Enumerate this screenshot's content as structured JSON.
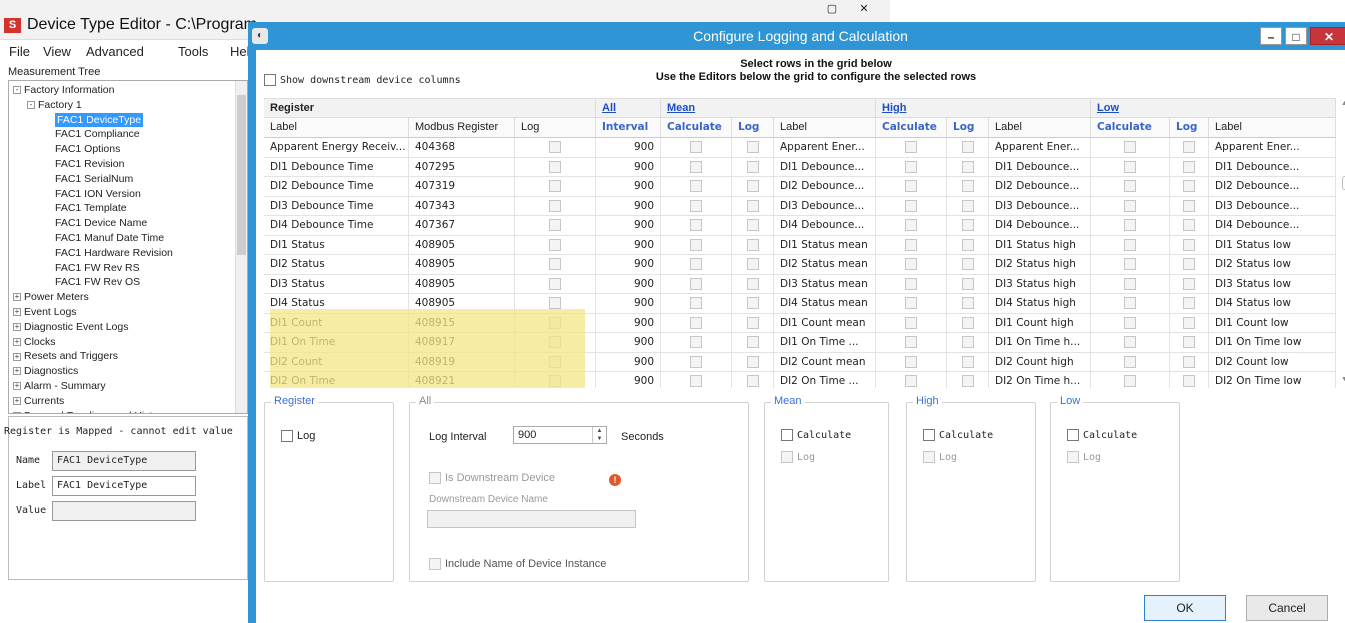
{
  "back_window": {
    "title": "Device Type Editor - C:\\Program",
    "logo": "S",
    "menu": [
      "File",
      "View",
      "Advanced",
      "Tools",
      "Hel"
    ],
    "tree_label": "Measurement Tree",
    "tree": [
      {
        "label": "Factory Information",
        "pm": "-",
        "indent": 0
      },
      {
        "label": "Factory 1",
        "pm": "-",
        "indent": 1
      },
      {
        "label": "FAC1 DeviceType",
        "indent": 2,
        "selected": true
      },
      {
        "label": "FAC1 Compliance",
        "indent": 2
      },
      {
        "label": "FAC1 Options",
        "indent": 2
      },
      {
        "label": "FAC1 Revision",
        "indent": 2
      },
      {
        "label": "FAC1 SerialNum",
        "indent": 2
      },
      {
        "label": "FAC1 ION Version",
        "indent": 2
      },
      {
        "label": "FAC1 Template",
        "indent": 2
      },
      {
        "label": "FAC1 Device Name",
        "indent": 2
      },
      {
        "label": "FAC1 Manuf Date Time",
        "indent": 2
      },
      {
        "label": "FAC1 Hardware Revision",
        "indent": 2
      },
      {
        "label": "FAC1 FW Rev RS",
        "indent": 2
      },
      {
        "label": "FAC1 FW Rev OS",
        "indent": 2
      },
      {
        "label": "Power Meters",
        "pm": "+",
        "indent": 0
      },
      {
        "label": "Event Logs",
        "pm": "+",
        "indent": 0
      },
      {
        "label": "Diagnostic Event Logs",
        "pm": "+",
        "indent": 0
      },
      {
        "label": "Clocks",
        "pm": "+",
        "indent": 0
      },
      {
        "label": "Resets and Triggers",
        "pm": "+",
        "indent": 0
      },
      {
        "label": "Diagnostics",
        "pm": "+",
        "indent": 0
      },
      {
        "label": "Alarm - Summary",
        "pm": "+",
        "indent": 0
      },
      {
        "label": "Currents",
        "pm": "+",
        "indent": 0
      },
      {
        "label": "Demand Readings and History",
        "pm": "+",
        "indent": 0
      }
    ],
    "note": "Register is Mapped - cannot edit value",
    "name_label": "Name",
    "name_value": "FAC1 DeviceType",
    "label_label": "Label",
    "label_value": "FAC1 DeviceType",
    "value_label": "Value",
    "value_value": ""
  },
  "dialog": {
    "title": "Configure Logging and Calculation",
    "show_downstream": "Show downstream device columns",
    "instructions_1": "Select rows in the grid below",
    "instructions_2": "Use the Editors below the grid to configure the selected rows",
    "group_headers": {
      "register": "Register",
      "all": "All",
      "mean": "Mean",
      "high": "High",
      "low": "Low"
    },
    "columns": [
      "Label",
      "Modbus Register",
      "Log",
      "Interval",
      "Calculate",
      "Log",
      "Label",
      "Calculate",
      "Log",
      "Label",
      "Calculate",
      "Log",
      "Label"
    ],
    "rows": [
      {
        "label": "Apparent Energy Receiv...",
        "reg": "404368",
        "interval": "900",
        "mean": "Apparent Ener...",
        "high": "Apparent Ener...",
        "low": "Apparent Ener..."
      },
      {
        "label": "DI1 Debounce Time",
        "reg": "407295",
        "interval": "900",
        "mean": "DI1 Debounce...",
        "high": "DI1 Debounce...",
        "low": "DI1 Debounce..."
      },
      {
        "label": "DI2 Debounce Time",
        "reg": "407319",
        "interval": "900",
        "mean": "DI2 Debounce...",
        "high": "DI2 Debounce...",
        "low": "DI2 Debounce..."
      },
      {
        "label": "DI3 Debounce Time",
        "reg": "407343",
        "interval": "900",
        "mean": "DI3 Debounce...",
        "high": "DI3 Debounce...",
        "low": "DI3 Debounce..."
      },
      {
        "label": "DI4 Debounce Time",
        "reg": "407367",
        "interval": "900",
        "mean": "DI4 Debounce...",
        "high": "DI4 Debounce...",
        "low": "DI4 Debounce..."
      },
      {
        "label": "DI1 Status",
        "reg": "408905",
        "interval": "900",
        "mean": "DI1 Status mean",
        "high": "DI1 Status high",
        "low": "DI1 Status low"
      },
      {
        "label": "DI2 Status",
        "reg": "408905",
        "interval": "900",
        "mean": "DI2 Status mean",
        "high": "DI2 Status high",
        "low": "DI2 Status low"
      },
      {
        "label": "DI3 Status",
        "reg": "408905",
        "interval": "900",
        "mean": "DI3 Status mean",
        "high": "DI3 Status high",
        "low": "DI3 Status low"
      },
      {
        "label": "DI4 Status",
        "reg": "408905",
        "interval": "900",
        "mean": "DI4 Status mean",
        "high": "DI4 Status high",
        "low": "DI4 Status low"
      },
      {
        "label": "DI1 Count",
        "reg": "408915",
        "interval": "900",
        "mean": "DI1 Count mean",
        "high": "DI1 Count high",
        "low": "DI1 Count low"
      },
      {
        "label": "DI1 On Time",
        "reg": "408917",
        "interval": "900",
        "mean": "DI1 On Time ...",
        "high": "DI1 On Time h...",
        "low": "DI1 On Time low"
      },
      {
        "label": "DI2 Count",
        "reg": "408919",
        "interval": "900",
        "mean": "DI2 Count mean",
        "high": "DI2 Count high",
        "low": "DI2 Count low"
      },
      {
        "label": "DI2 On Time",
        "reg": "408921",
        "interval": "900",
        "mean": "DI2 On Time ...",
        "high": "DI2 On Time h...",
        "low": "DI2 On Time low"
      }
    ],
    "editors": {
      "register_title": "Register",
      "register_log": "Log",
      "all_title": "All",
      "log_interval_label": "Log Interval",
      "log_interval_value": "900",
      "seconds": "Seconds",
      "is_downstream": "Is Downstream Device",
      "downstream_name": "Downstream Device Name",
      "include_name": "Include Name of Device Instance",
      "mean_title": "Mean",
      "high_title": "High",
      "low_title": "Low",
      "calculate": "Calculate",
      "log": "Log"
    },
    "ok": "OK",
    "cancel": "Cancel"
  },
  "colors": {
    "title_bar": "#2f95d4",
    "highlight": "#f4e685",
    "link": "#1a4fc4",
    "selected": "#3399ff"
  }
}
